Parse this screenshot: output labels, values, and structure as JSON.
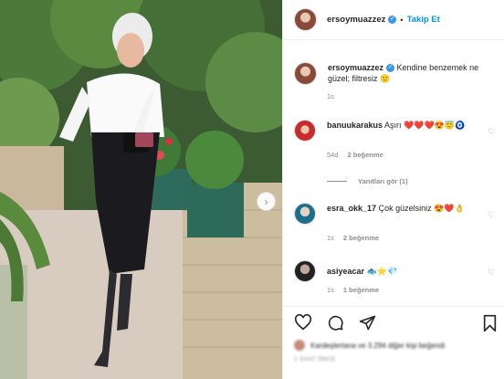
{
  "header": {
    "username": "ersoymuazzez",
    "separator": "•",
    "follow_label": "Takip Et"
  },
  "caption": {
    "username": "ersoymuazzez",
    "text": "Kendine benzemek ne güzel; filtresiz 🙂",
    "time": "1s"
  },
  "comments": [
    {
      "username": "banuukarakus",
      "text": "Aşırı ❤️❤️❤️😍😇🧿",
      "time": "54d",
      "likes": "2 beğenme",
      "avatar_color": "#c72c2c"
    },
    {
      "username": "esra_okk_17",
      "text": "Çok güzelsiniz 😍❤️👌",
      "time": "1s",
      "likes": "2 beğenme",
      "avatar_color": "#1c6f8a"
    },
    {
      "username": "asiyeacar",
      "text": "🐟⭐💎",
      "time": "1s",
      "likes": "1 beğenme",
      "avatar_color": "#222222"
    }
  ],
  "replies_label": "Yanıtları gör (1)",
  "footer": {
    "likes_text": "Kardeşlertana ve 3.294 diğer kişi beğendi",
    "time_text": "1 SAAT ÖNCE"
  },
  "icons": {
    "verified": "verified-badge-icon",
    "next": "chevron-right-icon",
    "like": "heart-icon",
    "comment": "comment-icon",
    "share": "share-icon",
    "save": "bookmark-icon"
  },
  "colors": {
    "accent": "#0095f6",
    "verified": "#3897f0",
    "muted": "#8e8e8e"
  }
}
